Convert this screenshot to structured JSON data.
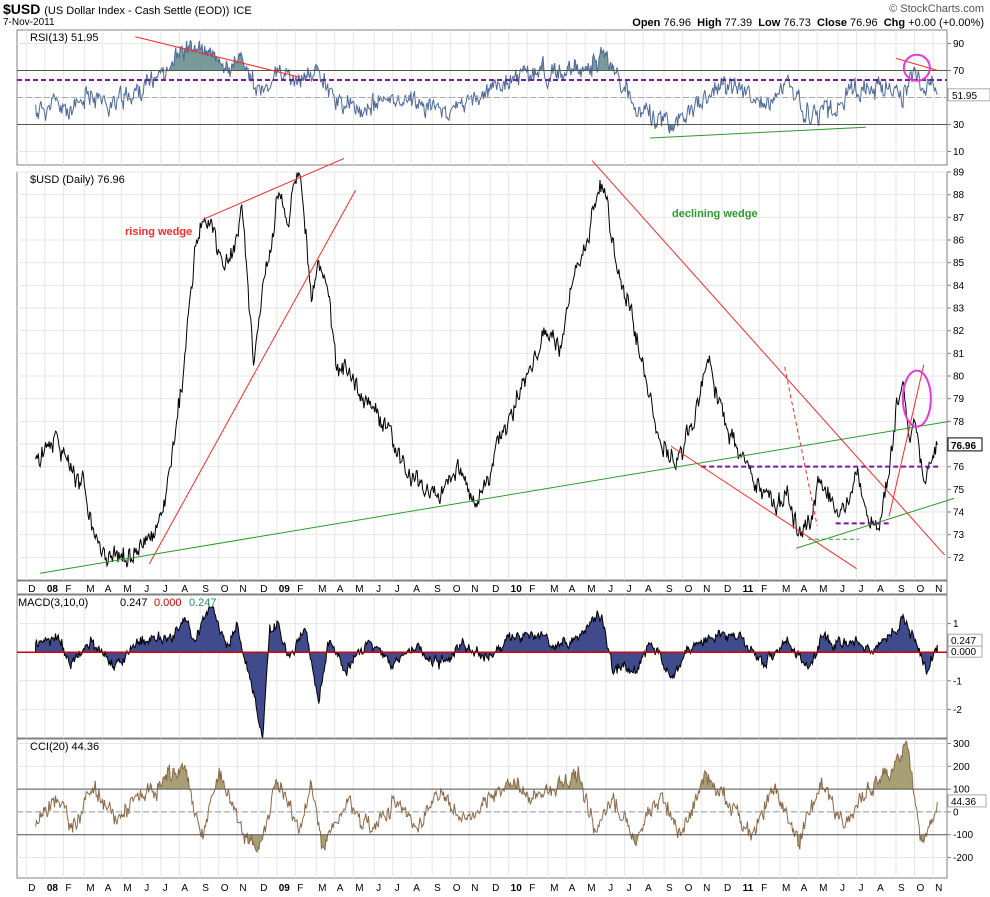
{
  "header": {
    "symbol": "$USD",
    "description": "(US Dollar Index - Cash Settle (EOD))",
    "exchange": "ICE",
    "date": "7-Nov-2011",
    "brand": "© StockCharts.com",
    "open_label": "Open",
    "open": "76.96",
    "high_label": "High",
    "high": "77.39",
    "low_label": "Low",
    "low": "76.73",
    "close_label": "Close",
    "close": "76.96",
    "chg_label": "Chg",
    "chg": "+0.00 (+0.00%)"
  },
  "colors": {
    "price": "#000000",
    "rsi": "#4f6a9a",
    "rsi_fill": "#5f8a8a",
    "macd_fill": "#3f4b8c",
    "cci": "#8a6a4a",
    "cci_fill": "#a8a074",
    "trend_red": "#ff2a2a",
    "trend_green": "#2e9a2e",
    "purple": "#7a1a9a",
    "magenta": "#e23adf"
  },
  "chart_data": [
    {
      "type": "line",
      "panel": "RSI",
      "label": "RSI(13) 51.95",
      "last_value": "51.95",
      "ylim": [
        0,
        100
      ],
      "yticks": [
        90,
        70,
        50,
        30,
        10
      ],
      "ytick_labels": [
        "90",
        "70",
        "50",
        "30",
        "10"
      ],
      "levels": [
        70,
        30
      ],
      "dashed_level": 63,
      "anchors": [
        [
          2007.96,
          40
        ],
        [
          2008.05,
          45
        ],
        [
          2008.12,
          38
        ],
        [
          2008.2,
          55
        ],
        [
          2008.27,
          44
        ],
        [
          2008.35,
          50
        ],
        [
          2008.45,
          60
        ],
        [
          2008.55,
          78
        ],
        [
          2008.62,
          88
        ],
        [
          2008.7,
          82
        ],
        [
          2008.78,
          70
        ],
        [
          2008.85,
          80
        ],
        [
          2008.93,
          50
        ],
        [
          2009.0,
          68
        ],
        [
          2009.1,
          60
        ],
        [
          2009.18,
          72
        ],
        [
          2009.26,
          48
        ],
        [
          2009.35,
          40
        ],
        [
          2009.45,
          46
        ],
        [
          2009.55,
          50
        ],
        [
          2009.65,
          44
        ],
        [
          2009.75,
          40
        ],
        [
          2009.85,
          48
        ],
        [
          2009.95,
          58
        ],
        [
          2010.05,
          66
        ],
        [
          2010.15,
          70
        ],
        [
          2010.25,
          66
        ],
        [
          2010.35,
          74
        ],
        [
          2010.42,
          84
        ],
        [
          2010.5,
          52
        ],
        [
          2010.6,
          38
        ],
        [
          2010.7,
          30
        ],
        [
          2010.8,
          40
        ],
        [
          2010.9,
          56
        ],
        [
          2011.0,
          60
        ],
        [
          2011.1,
          40
        ],
        [
          2011.2,
          58
        ],
        [
          2011.3,
          36
        ],
        [
          2011.4,
          40
        ],
        [
          2011.5,
          56
        ],
        [
          2011.6,
          60
        ],
        [
          2011.7,
          52
        ],
        [
          2011.75,
          68
        ],
        [
          2011.8,
          58
        ],
        [
          2011.85,
          52
        ]
      ]
    },
    {
      "type": "line",
      "panel": "Price",
      "label": "$USD (Daily) 76.96",
      "last_value": "76.96",
      "ylim": [
        71,
        89
      ],
      "yticks": [
        72,
        73,
        74,
        75,
        76,
        77,
        78,
        79,
        80,
        81,
        82,
        83,
        84,
        85,
        86,
        87,
        88,
        89
      ],
      "ytick_labels": [
        "72",
        "73",
        "74",
        "75",
        "76",
        "77",
        "78",
        "79",
        "80",
        "81",
        "82",
        "83",
        "84",
        "85",
        "86",
        "87",
        "88",
        "89"
      ],
      "x": [
        2007.96,
        2008.05,
        2008.12,
        2008.17,
        2008.21,
        2008.27,
        2008.33,
        2008.4,
        2008.46,
        2008.5,
        2008.55,
        2008.6,
        2008.66,
        2008.72,
        2008.77,
        2008.82,
        2008.85,
        2008.9,
        2008.94,
        2008.98,
        2009.0,
        2009.05,
        2009.1,
        2009.15,
        2009.18,
        2009.22,
        2009.26,
        2009.3,
        2009.35,
        2009.42,
        2009.48,
        2009.55,
        2009.62,
        2009.7,
        2009.78,
        2009.85,
        2009.92,
        2009.96,
        2010.0,
        2010.05,
        2010.1,
        2010.15,
        2010.22,
        2010.28,
        2010.34,
        2010.4,
        2010.43,
        2010.46,
        2010.5,
        2010.55,
        2010.6,
        2010.66,
        2010.72,
        2010.77,
        2010.82,
        2010.86,
        2010.9,
        2010.95,
        2011.0,
        2011.05,
        2011.1,
        2011.15,
        2011.2,
        2011.25,
        2011.3,
        2011.34,
        2011.38,
        2011.42,
        2011.46,
        2011.5,
        2011.55,
        2011.6,
        2011.64,
        2011.67,
        2011.7,
        2011.73,
        2011.75,
        2011.77,
        2011.79,
        2011.82,
        2011.85
      ],
      "values": [
        76.2,
        77.5,
        75.5,
        75.0,
        73.0,
        72.0,
        71.8,
        72.5,
        72.8,
        73.5,
        76.5,
        80.5,
        86.5,
        87.0,
        84.5,
        85.5,
        87.5,
        80.5,
        84.0,
        86.0,
        88.0,
        87.0,
        89.0,
        83.5,
        85.0,
        84.0,
        80.0,
        80.5,
        79.5,
        78.5,
        77.5,
        76.0,
        75.0,
        74.8,
        76.0,
        74.5,
        75.5,
        77.5,
        78.0,
        79.5,
        80.5,
        82.0,
        81.0,
        84.5,
        86.0,
        88.5,
        87.0,
        85.0,
        83.5,
        82.0,
        79.5,
        77.0,
        76.0,
        77.5,
        79.0,
        81.0,
        79.0,
        77.5,
        76.5,
        75.5,
        75.0,
        74.2,
        74.8,
        73.0,
        73.3,
        75.8,
        74.5,
        73.8,
        74.2,
        75.5,
        73.8,
        73.5,
        76.0,
        78.5,
        79.5,
        77.5,
        78.0,
        77.0,
        75.0,
        76.5,
        76.96
      ],
      "annotations": [
        "rising wedge",
        "declining wedge"
      ],
      "support_level": 76.0,
      "support_level_2": 73.5,
      "support_level_3": 72.8
    },
    {
      "type": "area",
      "panel": "MACD",
      "label_prefix": "MACD(3,10,0)",
      "values_text": [
        "0.247",
        "0.000",
        "0.247"
      ],
      "last_value": "0.247",
      "signal_value": "0.000",
      "ylim": [
        -3,
        2
      ],
      "yticks": [
        1,
        -1,
        -2
      ],
      "ytick_labels": [
        "1",
        "-1",
        "-2"
      ],
      "anchors": [
        [
          2007.96,
          0.3
        ],
        [
          2008.05,
          0.5
        ],
        [
          2008.12,
          -0.4
        ],
        [
          2008.2,
          0.4
        ],
        [
          2008.3,
          -0.5
        ],
        [
          2008.4,
          0.3
        ],
        [
          2008.5,
          0.5
        ],
        [
          2008.55,
          0.6
        ],
        [
          2008.6,
          1.2
        ],
        [
          2008.65,
          0.5
        ],
        [
          2008.72,
          1.8
        ],
        [
          2008.78,
          0.3
        ],
        [
          2008.83,
          0.9
        ],
        [
          2008.9,
          -1.5
        ],
        [
          2008.94,
          -3.0
        ],
        [
          2008.97,
          0.8
        ],
        [
          2009.0,
          1.1
        ],
        [
          2009.05,
          -0.3
        ],
        [
          2009.12,
          0.9
        ],
        [
          2009.18,
          -1.6
        ],
        [
          2009.22,
          0.3
        ],
        [
          2009.3,
          -0.6
        ],
        [
          2009.4,
          0.4
        ],
        [
          2009.5,
          -0.5
        ],
        [
          2009.6,
          0.2
        ],
        [
          2009.7,
          -0.4
        ],
        [
          2009.8,
          0.3
        ],
        [
          2009.9,
          -0.2
        ],
        [
          2010.0,
          0.5
        ],
        [
          2010.1,
          0.7
        ],
        [
          2010.2,
          0.2
        ],
        [
          2010.3,
          0.6
        ],
        [
          2010.35,
          1.1
        ],
        [
          2010.4,
          1.3
        ],
        [
          2010.45,
          -0.6
        ],
        [
          2010.55,
          -0.6
        ],
        [
          2010.62,
          0.4
        ],
        [
          2010.7,
          -0.8
        ],
        [
          2010.8,
          0.2
        ],
        [
          2010.9,
          0.6
        ],
        [
          2011.0,
          0.5
        ],
        [
          2011.1,
          -0.5
        ],
        [
          2011.2,
          0.4
        ],
        [
          2011.3,
          -0.6
        ],
        [
          2011.35,
          0.5
        ],
        [
          2011.4,
          0.2
        ],
        [
          2011.5,
          0.4
        ],
        [
          2011.58,
          0.1
        ],
        [
          2011.65,
          0.6
        ],
        [
          2011.7,
          1.2
        ],
        [
          2011.75,
          0.5
        ],
        [
          2011.8,
          -0.8
        ],
        [
          2011.85,
          0.25
        ]
      ]
    },
    {
      "type": "line",
      "panel": "CCI",
      "label": "CCI(20) 44.36",
      "last_value": "44.36",
      "ylim": [
        -290,
        320
      ],
      "yticks": [
        300,
        200,
        100,
        0,
        -100,
        -200
      ],
      "ytick_labels": [
        "300",
        "200",
        "100",
        "0",
        "-100",
        "-200"
      ],
      "levels": [
        100,
        -100
      ],
      "anchors": [
        [
          2007.96,
          -50
        ],
        [
          2008.05,
          80
        ],
        [
          2008.12,
          -80
        ],
        [
          2008.2,
          120
        ],
        [
          2008.3,
          -40
        ],
        [
          2008.4,
          60
        ],
        [
          2008.5,
          120
        ],
        [
          2008.6,
          200
        ],
        [
          2008.68,
          -120
        ],
        [
          2008.75,
          180
        ],
        [
          2008.85,
          -60
        ],
        [
          2008.92,
          -200
        ],
        [
          2009.0,
          150
        ],
        [
          2009.1,
          -80
        ],
        [
          2009.15,
          120
        ],
        [
          2009.2,
          -160
        ],
        [
          2009.3,
          60
        ],
        [
          2009.4,
          -80
        ],
        [
          2009.5,
          40
        ],
        [
          2009.6,
          -60
        ],
        [
          2009.7,
          100
        ],
        [
          2009.8,
          -40
        ],
        [
          2009.9,
          20
        ],
        [
          2010.0,
          140
        ],
        [
          2010.1,
          60
        ],
        [
          2010.2,
          120
        ],
        [
          2010.3,
          160
        ],
        [
          2010.38,
          -100
        ],
        [
          2010.45,
          60
        ],
        [
          2010.55,
          -140
        ],
        [
          2010.65,
          80
        ],
        [
          2010.75,
          -80
        ],
        [
          2010.85,
          160
        ],
        [
          2010.95,
          40
        ],
        [
          2011.05,
          -100
        ],
        [
          2011.15,
          120
        ],
        [
          2011.25,
          -140
        ],
        [
          2011.35,
          120
        ],
        [
          2011.45,
          -60
        ],
        [
          2011.55,
          100
        ],
        [
          2011.65,
          180
        ],
        [
          2011.72,
          290
        ],
        [
          2011.78,
          -150
        ],
        [
          2011.85,
          44
        ]
      ]
    }
  ],
  "x_axis": {
    "labels": [
      {
        "t": 2007.92,
        "s": "D"
      },
      {
        "t": 2008.0,
        "s": "08",
        "bold": true
      },
      {
        "t": 2008.08,
        "s": "F"
      },
      {
        "t": 2008.17,
        "s": "M"
      },
      {
        "t": 2008.25,
        "s": "A"
      },
      {
        "t": 2008.33,
        "s": "M"
      },
      {
        "t": 2008.42,
        "s": "J"
      },
      {
        "t": 2008.5,
        "s": "J"
      },
      {
        "t": 2008.58,
        "s": "A"
      },
      {
        "t": 2008.67,
        "s": "S"
      },
      {
        "t": 2008.75,
        "s": "O"
      },
      {
        "t": 2008.83,
        "s": "N"
      },
      {
        "t": 2008.92,
        "s": "D"
      },
      {
        "t": 2009.0,
        "s": "09",
        "bold": true
      },
      {
        "t": 2009.08,
        "s": "F"
      },
      {
        "t": 2009.17,
        "s": "M"
      },
      {
        "t": 2009.25,
        "s": "A"
      },
      {
        "t": 2009.33,
        "s": "M"
      },
      {
        "t": 2009.42,
        "s": "J"
      },
      {
        "t": 2009.5,
        "s": "J"
      },
      {
        "t": 2009.58,
        "s": "A"
      },
      {
        "t": 2009.67,
        "s": "S"
      },
      {
        "t": 2009.75,
        "s": "O"
      },
      {
        "t": 2009.83,
        "s": "N"
      },
      {
        "t": 2009.92,
        "s": "D"
      },
      {
        "t": 2010.0,
        "s": "10",
        "bold": true
      },
      {
        "t": 2010.08,
        "s": "F"
      },
      {
        "t": 2010.17,
        "s": "M"
      },
      {
        "t": 2010.25,
        "s": "A"
      },
      {
        "t": 2010.33,
        "s": "M"
      },
      {
        "t": 2010.42,
        "s": "J"
      },
      {
        "t": 2010.5,
        "s": "J"
      },
      {
        "t": 2010.58,
        "s": "A"
      },
      {
        "t": 2010.67,
        "s": "S"
      },
      {
        "t": 2010.75,
        "s": "O"
      },
      {
        "t": 2010.83,
        "s": "N"
      },
      {
        "t": 2010.92,
        "s": "D"
      },
      {
        "t": 2011.0,
        "s": "11",
        "bold": true
      },
      {
        "t": 2011.08,
        "s": "F"
      },
      {
        "t": 2011.17,
        "s": "M"
      },
      {
        "t": 2011.25,
        "s": "A"
      },
      {
        "t": 2011.33,
        "s": "M"
      },
      {
        "t": 2011.42,
        "s": "J"
      },
      {
        "t": 2011.5,
        "s": "J"
      },
      {
        "t": 2011.58,
        "s": "A"
      },
      {
        "t": 2011.67,
        "s": "S"
      },
      {
        "t": 2011.75,
        "s": "O"
      },
      {
        "t": 2011.83,
        "s": "N"
      }
    ]
  },
  "trendlines": [
    {
      "name": "rising-wedge-upper",
      "c": "red",
      "pts": [
        [
          2008.68,
          86.9
        ],
        [
          2009.29,
          89.6
        ]
      ]
    },
    {
      "name": "rising-wedge-lower",
      "c": "red",
      "pts": [
        [
          2008.45,
          71.7
        ],
        [
          2009.34,
          88.2
        ]
      ]
    },
    {
      "name": "long-green-support",
      "c": "green",
      "pts": [
        [
          2007.98,
          71.3
        ],
        [
          2011.9,
          78.0
        ]
      ]
    },
    {
      "name": "declining-wedge-upper",
      "c": "red",
      "pts": [
        [
          2010.36,
          89.5
        ],
        [
          2011.88,
          72.1
        ]
      ]
    },
    {
      "name": "declining-wedge-lower",
      "c": "red",
      "pts": [
        [
          2010.7,
          76.9
        ],
        [
          2011.5,
          71.5
        ]
      ]
    },
    {
      "name": "short-dashed-red",
      "c": "red",
      "dash": true,
      "pts": [
        [
          2011.19,
          80.4
        ],
        [
          2011.33,
          73.4
        ]
      ]
    },
    {
      "name": "green-support-2",
      "c": "green",
      "pts": [
        [
          2011.24,
          72.4
        ],
        [
          2011.92,
          74.6
        ]
      ]
    },
    {
      "name": "sep-breakout-red",
      "c": "red",
      "pts": [
        [
          2011.64,
          73.8
        ],
        [
          2011.79,
          80.5
        ]
      ]
    },
    {
      "name": "rsi-red-down-1",
      "c": "red",
      "panel": "rsi",
      "pts": [
        [
          2008.39,
          95
        ],
        [
          2009.1,
          65
        ]
      ]
    },
    {
      "name": "rsi-green-up",
      "c": "green",
      "panel": "rsi",
      "pts": [
        [
          2010.61,
          20
        ],
        [
          2011.54,
          28
        ]
      ]
    },
    {
      "name": "rsi-red-down-2",
      "c": "red",
      "panel": "rsi",
      "pts": [
        [
          2011.67,
          79
        ],
        [
          2011.85,
          70
        ]
      ]
    }
  ]
}
